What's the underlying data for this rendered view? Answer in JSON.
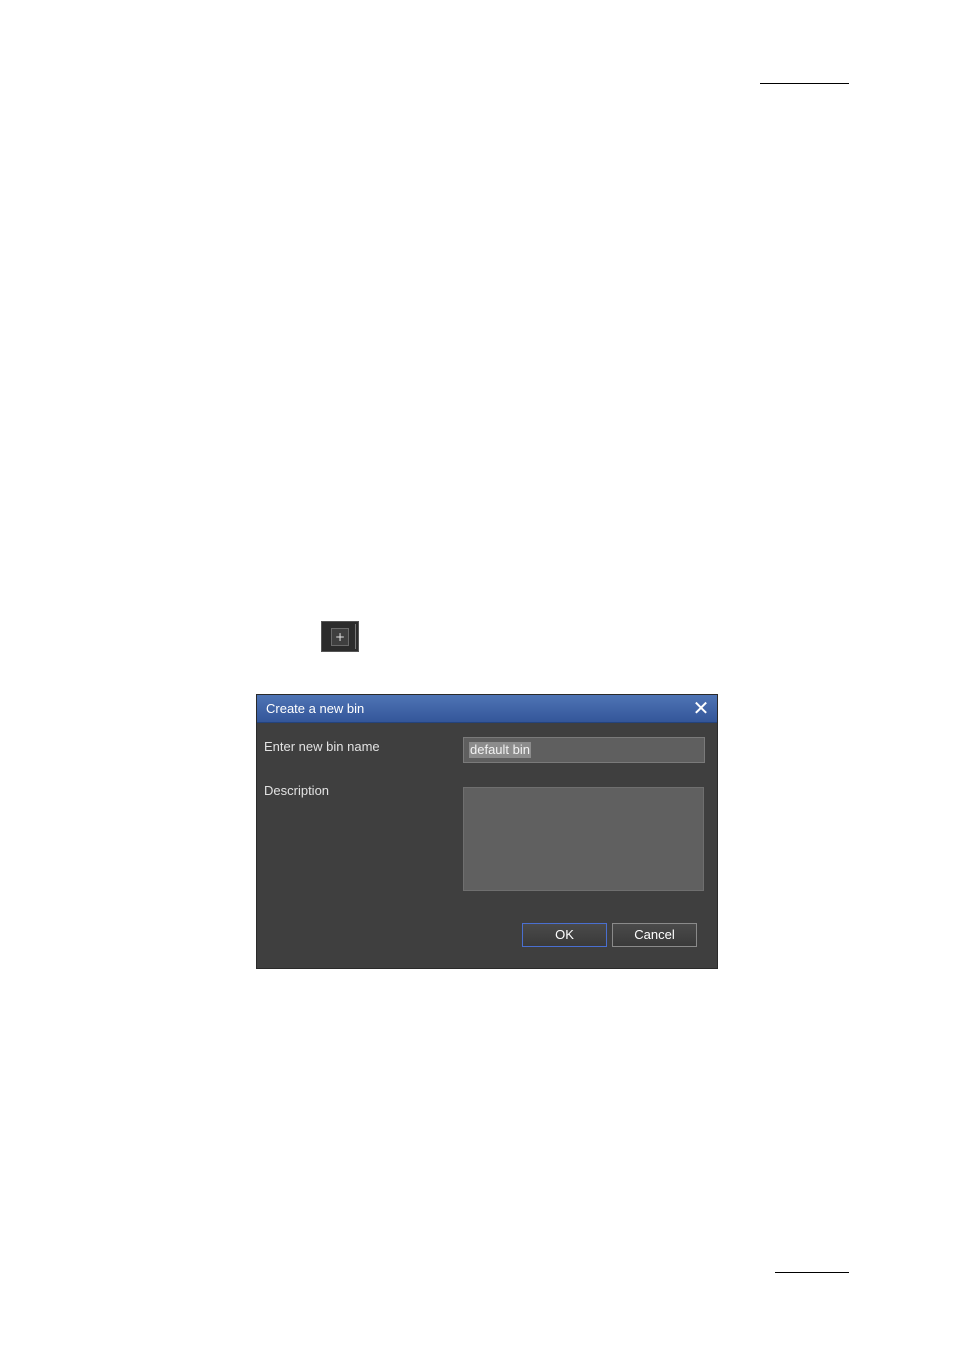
{
  "toolbar": {
    "add_label": "+"
  },
  "dialog": {
    "title": "Create a new bin",
    "close_glyph": "✕",
    "name_label": "Enter new bin name",
    "name_value": "default bin",
    "description_label": "Description",
    "description_value": "",
    "ok_label": "OK",
    "cancel_label": "Cancel"
  },
  "colors": {
    "titlebar": "#3f62a8",
    "dialog_bg": "#3f3f3f",
    "ok_border": "#4a6fd0"
  }
}
